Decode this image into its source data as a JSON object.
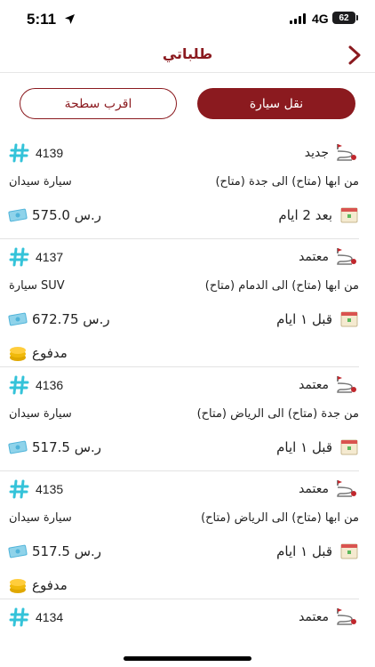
{
  "status_bar": {
    "time": "5:11",
    "network": "4G",
    "battery": "62"
  },
  "nav": {
    "title": "طلباتي",
    "back_icon": "chevron-right-icon"
  },
  "tabs": {
    "transport": "نقل سيارة",
    "nearest": "اقرب سطحة"
  },
  "colors": {
    "brand": "#8b1a1f",
    "divider": "#e3e3e3",
    "hash": "#34c3d9"
  },
  "orders": [
    {
      "id": "4139",
      "status": "جديد",
      "route": "من ابها (متاح) الى جدة (متاح)",
      "vehicle": "سيارة سيدان",
      "price": "575.0 ر.س",
      "date": "بعد 2 ايام",
      "paid": ""
    },
    {
      "id": "4137",
      "status": "معتمد",
      "route": "من ابها (متاح) الى الدمام (متاح)",
      "vehicle": "سيارة SUV",
      "price": "672.75 ر.س",
      "date": "قبل ١ ايام",
      "paid": "مدفوع"
    },
    {
      "id": "4136",
      "status": "معتمد",
      "route": "من جدة (متاح) الى الرياض (متاح)",
      "vehicle": "سيارة سيدان",
      "price": "517.5 ر.س",
      "date": "قبل ١ ايام",
      "paid": ""
    },
    {
      "id": "4135",
      "status": "معتمد",
      "route": "من ابها (متاح) الى الرياض (متاح)",
      "vehicle": "سيارة سيدان",
      "price": "517.5 ر.س",
      "date": "قبل ١ ايام",
      "paid": "مدفوع"
    },
    {
      "id": "4134",
      "status": "معتمد",
      "route": "",
      "vehicle": "",
      "price": "",
      "date": "",
      "paid": ""
    }
  ]
}
